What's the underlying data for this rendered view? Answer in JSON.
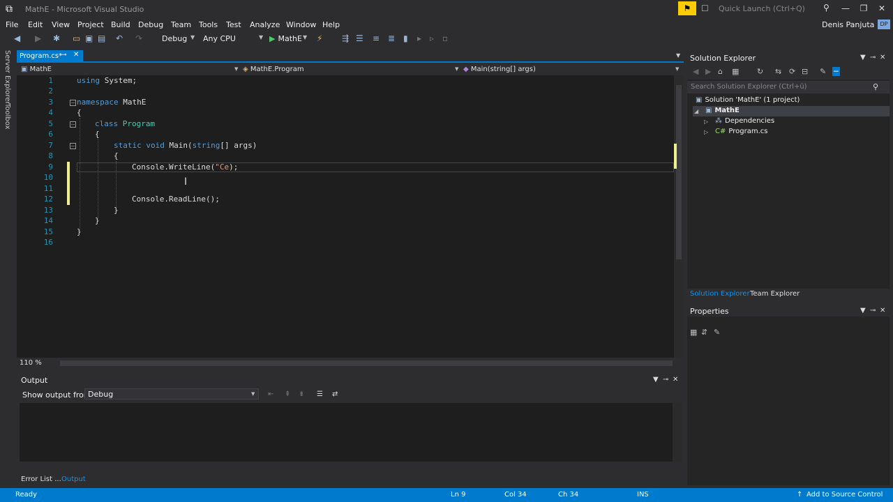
{
  "window": {
    "title": "MathE - Microsoft Visual Studio",
    "quick_launch_placeholder": "Quick Launch (Ctrl+Q)",
    "user": "Denis Panjuta",
    "avatar_initials": "DP"
  },
  "menu": [
    "File",
    "Edit",
    "View",
    "Project",
    "Build",
    "Debug",
    "Team",
    "Tools",
    "Test",
    "Analyze",
    "Window",
    "Help"
  ],
  "toolbar": {
    "configuration": "Debug",
    "platform": "Any CPU",
    "start_target": "MathE"
  },
  "side_tabs": [
    "Server Explorer",
    "Toolbox"
  ],
  "editor": {
    "tab_label": "Program.cs*",
    "nav": {
      "project": "MathE",
      "class": "MathE.Program",
      "member": "Main(string[] args)"
    },
    "line_numbers": [
      "1",
      "2",
      "3",
      "4",
      "5",
      "6",
      "7",
      "8",
      "9",
      "10",
      "11",
      "12",
      "13",
      "14",
      "15",
      "16"
    ],
    "code": {
      "l1_kw": "using",
      "l1_rest": " System;",
      "l3_kw": "namespace",
      "l3_rest": " MathE",
      "l4": "{",
      "l5_kw": "class",
      "l5_type": "Program",
      "l6": "{",
      "l7_kw1": "static",
      "l7_kw2": "void",
      "l7_name": "Main(",
      "l7_kw3": "string",
      "l7_rest": "[] args)",
      "l8": "{",
      "l9_pre": "Console.WriteLine(",
      "l9_str": "\"Ce",
      "l9_post": ");",
      "l12": "Console.ReadLine();",
      "l13": "}",
      "l14": "}",
      "l15": "}"
    },
    "zoom": "110 %"
  },
  "output": {
    "title": "Output",
    "show_from_label": "Show output from:",
    "source": "Debug"
  },
  "bottom_tabs": [
    "Error List ...",
    "Output"
  ],
  "solution_explorer": {
    "title": "Solution Explorer",
    "search_placeholder": "Search Solution Explorer (Ctrl+ü)",
    "tree": {
      "solution": "Solution 'MathE' (1 project)",
      "project": "MathE",
      "dependencies": "Dependencies",
      "file": "Program.cs"
    },
    "tabs": [
      "Solution Explorer",
      "Team Explorer"
    ]
  },
  "properties": {
    "title": "Properties"
  },
  "status": {
    "state": "Ready",
    "ln": "Ln 9",
    "col": "Col 34",
    "ch": "Ch 34",
    "mode": "INS",
    "source_control": "Add to Source Control"
  },
  "colors": {
    "accent": "#007acc",
    "keyword": "#569cd6",
    "type": "#4ec9b0",
    "string": "#d69d85",
    "line_number": "#2b91af",
    "editor_bg": "#1e1e1e",
    "notification": "#ffcc00"
  }
}
